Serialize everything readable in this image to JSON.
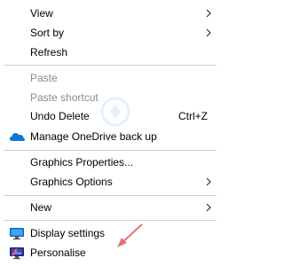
{
  "context_menu": {
    "items": [
      {
        "label": "View"
      },
      {
        "label": "Sort by"
      },
      {
        "label": "Refresh"
      },
      {
        "label": "Paste"
      },
      {
        "label": "Paste shortcut"
      },
      {
        "label": "Undo Delete",
        "shortcut": "Ctrl+Z"
      },
      {
        "label": "Manage OneDrive back up",
        "icon": "onedrive-cloud-icon"
      },
      {
        "label": "Graphics Properties..."
      },
      {
        "label": "Graphics Options"
      },
      {
        "label": "New"
      },
      {
        "label": "Display settings",
        "icon": "display-settings-icon"
      },
      {
        "label": "Personalise",
        "icon": "personalise-icon"
      }
    ]
  },
  "colors": {
    "disabled_text": "#8a8a8a",
    "separator": "#d0d0d0",
    "onedrive": "#0f78d4",
    "annotation_arrow": "#e57373"
  }
}
